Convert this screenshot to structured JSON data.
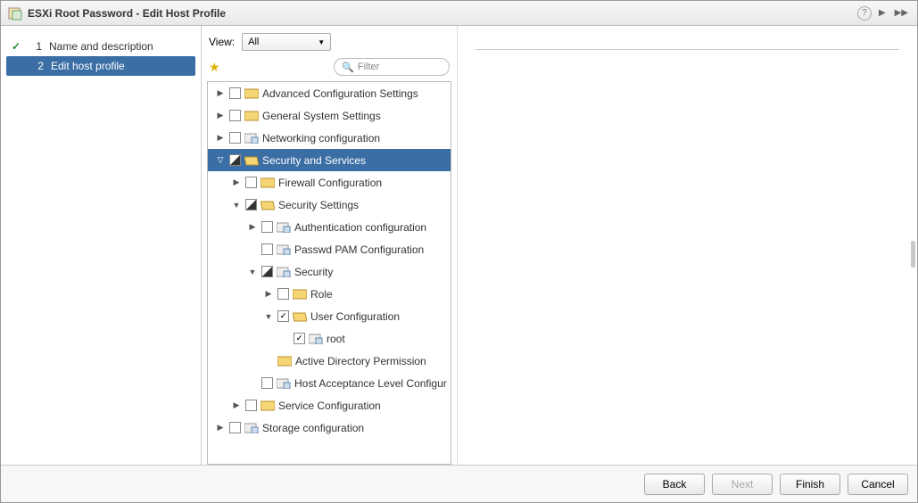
{
  "titlebar": {
    "title": "ESXi Root Password - Edit Host Profile"
  },
  "steps": {
    "s1": {
      "num": "1",
      "label": "Name and description"
    },
    "s2": {
      "num": "2",
      "label": "Edit host profile"
    }
  },
  "view": {
    "label": "View:",
    "value": "All"
  },
  "filter": {
    "placeholder": "Filter"
  },
  "tree": {
    "n1": "Advanced Configuration Settings",
    "n2": "General System Settings",
    "n3": "Networking configuration",
    "n4": "Security and Services",
    "n41": "Firewall Configuration",
    "n42": "Security Settings",
    "n421": "Authentication configuration",
    "n422": "Passwd PAM Configuration",
    "n423": "Security",
    "n4231": "Role",
    "n4232": "User Configuration",
    "n42321": "root",
    "n4233": "Active Directory Permission",
    "n424": "Host Acceptance Level Configur",
    "n43": "Service Configuration",
    "n5": "Storage configuration"
  },
  "footer": {
    "back": "Back",
    "next": "Next",
    "finish": "Finish",
    "cancel": "Cancel"
  }
}
